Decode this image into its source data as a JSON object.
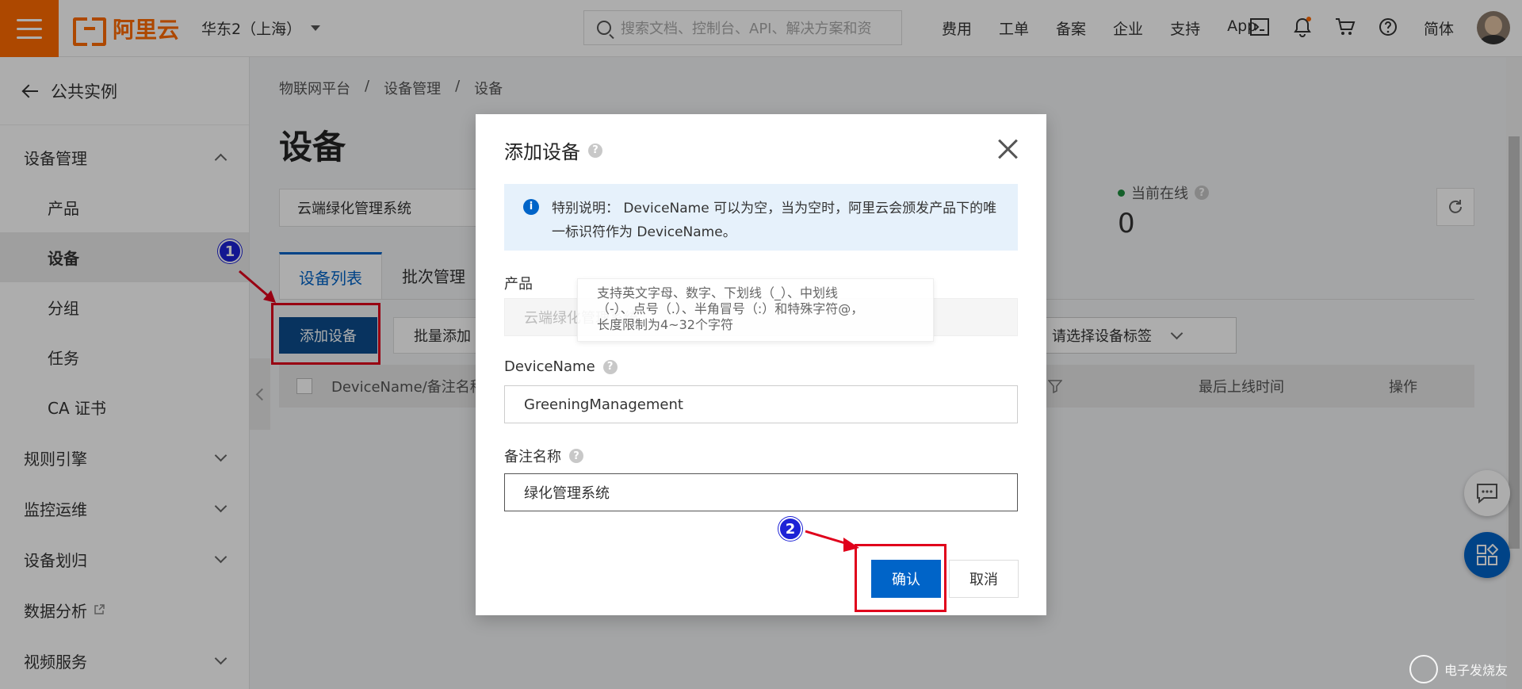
{
  "topbar": {
    "logo_text": "阿里云",
    "region": "华东2（上海）",
    "search_placeholder": "搜索文档、控制台、API、解决方案和资",
    "links": [
      "费用",
      "工单",
      "备案",
      "企业",
      "支持",
      "App"
    ],
    "lang": "简体"
  },
  "sidebar": {
    "back_label": "公共实例",
    "group_device_mgmt": "设备管理",
    "items": [
      "产品",
      "设备",
      "分组",
      "任务",
      "CA 证书"
    ],
    "groups": [
      "规则引擎",
      "监控运维",
      "设备划归",
      "数据分析",
      "视频服务"
    ]
  },
  "main": {
    "breadcrumb": [
      "物联网平台",
      "设备管理",
      "设备"
    ],
    "separator": "/",
    "title": "设备",
    "product_filter": "云端绿化管理系统",
    "online_label": "当前在线",
    "online_value": "0",
    "tabs": [
      "设备列表",
      "批次管理"
    ],
    "add_device_label": "添加设备",
    "batch_add_label": "批量添加",
    "tag_select_placeholder": "请选择设备标签",
    "columns": [
      "DeviceName/备注名称",
      "最后上线时间",
      "操作"
    ]
  },
  "dialog": {
    "title": "添加设备",
    "notice_prefix": "特别说明：",
    "notice_text": "DeviceName 可以为空，当为空时，阿里云会颁发产品下的唯一标识符作为 DeviceName。",
    "product_label": "产品",
    "product_value": "云端绿化管理系统",
    "tooltip_line1": "支持英文字母、数字、下划线（_）、中划线",
    "tooltip_line2": "（-）、点号（.）、半角冒号（:）和特殊字符@，",
    "tooltip_line3": "长度限制为4~32个字符",
    "devicename_label": "DeviceName",
    "devicename_value": "GreeningManagement",
    "remark_label": "备注名称",
    "remark_value": "绿化管理系统",
    "confirm_label": "确认",
    "cancel_label": "取消"
  },
  "annotations": [
    "1",
    "2"
  ],
  "watermark_text": "电子发烧友",
  "colors": {
    "brand": "#ff6a00",
    "primary": "#0064c8",
    "annotation": "#e0001b"
  }
}
